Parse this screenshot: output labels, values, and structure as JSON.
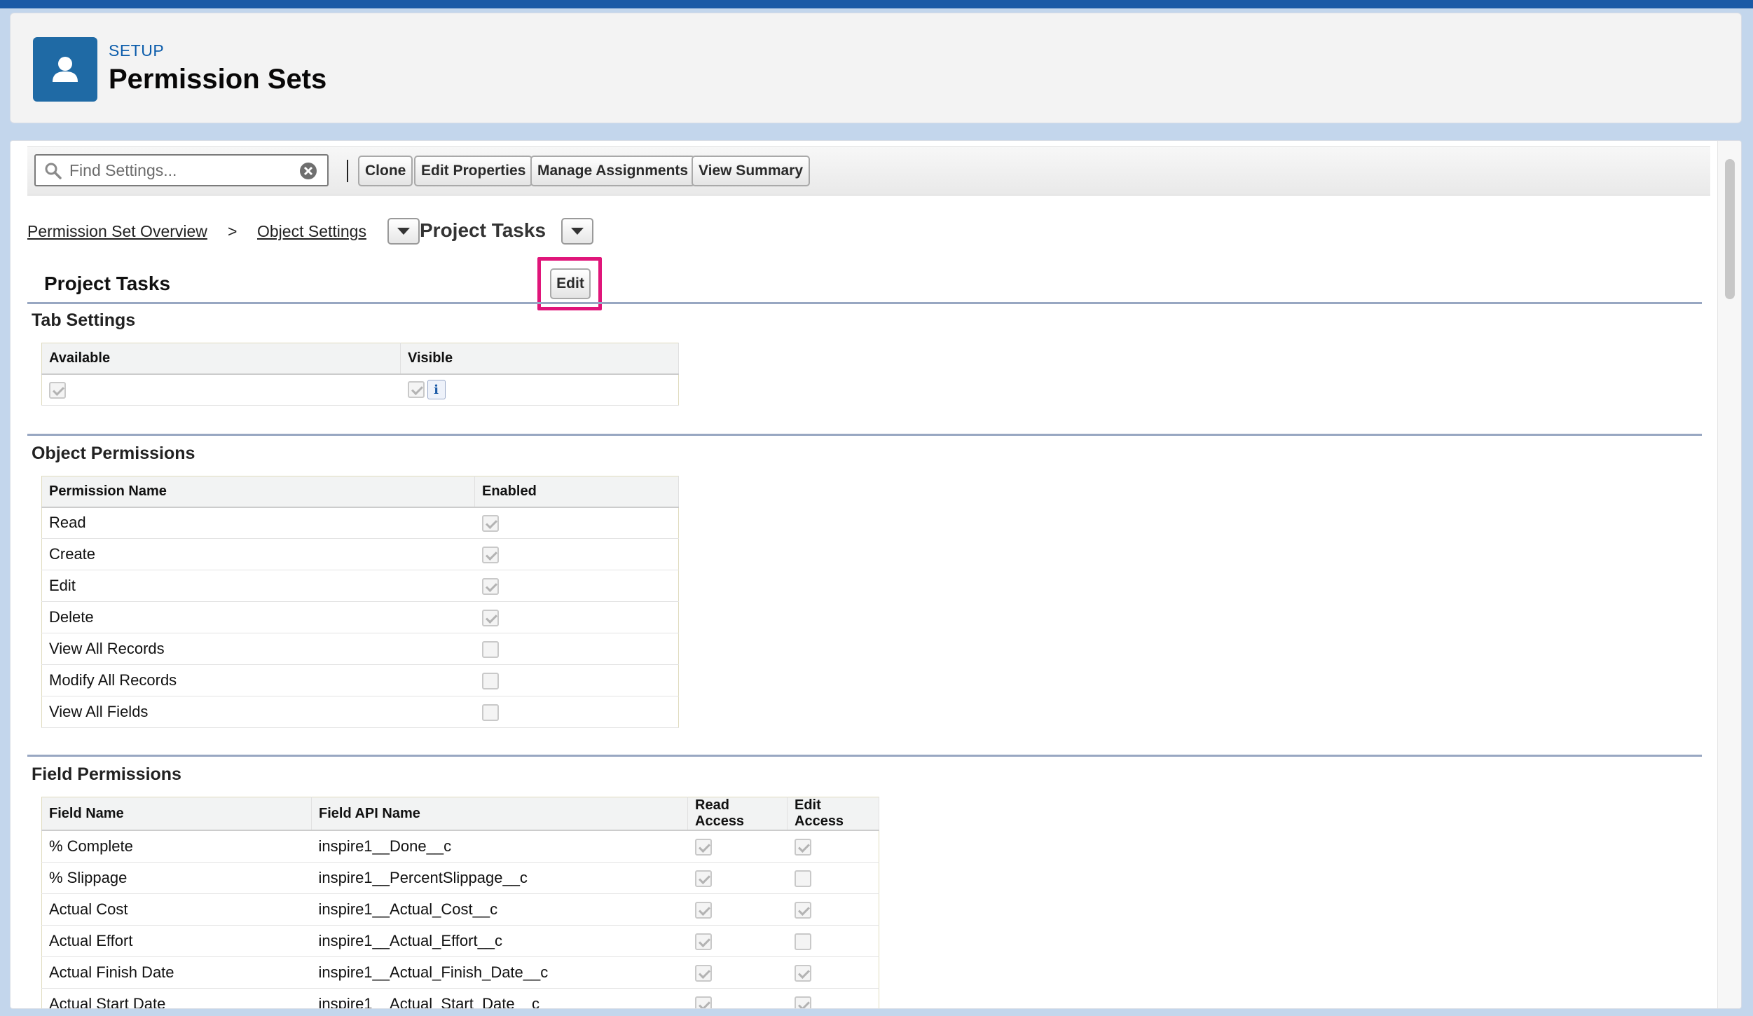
{
  "header": {
    "eyebrow": "SETUP",
    "title": "Permission Sets",
    "icon": "user-icon"
  },
  "toolbar": {
    "search_placeholder": "Find Settings...",
    "buttons": [
      "Clone",
      "Edit Properties",
      "Manage Assignments",
      "View Summary"
    ]
  },
  "breadcrumb": {
    "overview": "Permission Set Overview",
    "separator": ">",
    "object_settings": "Object Settings",
    "current": "Project Tasks"
  },
  "object_section": {
    "title": "Project Tasks",
    "edit_label": "Edit"
  },
  "tab_settings": {
    "title": "Tab Settings",
    "headers": [
      "Available",
      "Visible"
    ],
    "available": true,
    "visible": true
  },
  "object_permissions": {
    "title": "Object Permissions",
    "headers": [
      "Permission Name",
      "Enabled"
    ],
    "rows": [
      {
        "name": "Read",
        "enabled": true
      },
      {
        "name": "Create",
        "enabled": true
      },
      {
        "name": "Edit",
        "enabled": true
      },
      {
        "name": "Delete",
        "enabled": true
      },
      {
        "name": "View All Records",
        "enabled": false
      },
      {
        "name": "Modify All Records",
        "enabled": false
      },
      {
        "name": "View All Fields",
        "enabled": false
      }
    ]
  },
  "field_permissions": {
    "title": "Field Permissions",
    "headers": [
      "Field Name",
      "Field API Name",
      "Read Access",
      "Edit Access"
    ],
    "rows": [
      {
        "name": "% Complete",
        "api": "inspire1__Done__c",
        "read": true,
        "edit": true
      },
      {
        "name": "% Slippage",
        "api": "inspire1__PercentSlippage__c",
        "read": true,
        "edit": false
      },
      {
        "name": "Actual Cost",
        "api": "inspire1__Actual_Cost__c",
        "read": true,
        "edit": true
      },
      {
        "name": "Actual Effort",
        "api": "inspire1__Actual_Effort__c",
        "read": true,
        "edit": false
      },
      {
        "name": "Actual Finish Date",
        "api": "inspire1__Actual_Finish_Date__c",
        "read": true,
        "edit": true
      },
      {
        "name": "Actual Start Date",
        "api": "inspire1__Actual_Start_Date__c",
        "read": true,
        "edit": true
      }
    ]
  },
  "colors": {
    "brand": "#1f6aa5",
    "highlight": "#e0157a",
    "link": "#0b5cab"
  }
}
